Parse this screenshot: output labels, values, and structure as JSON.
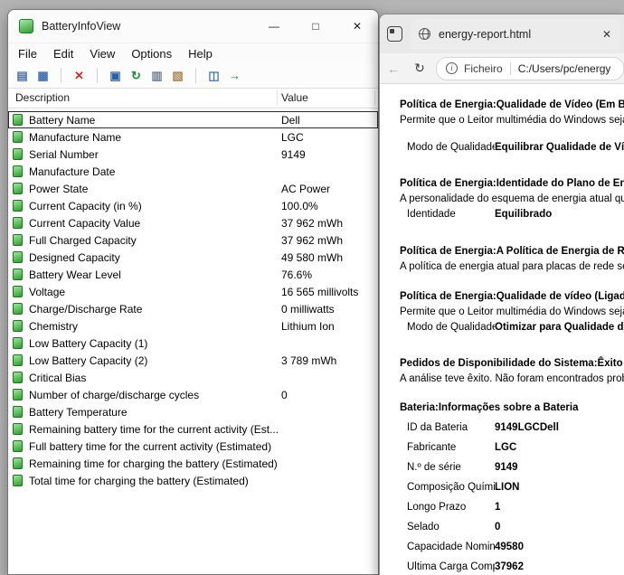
{
  "battery_window": {
    "title": "BatteryInfoView",
    "controls": {
      "minimize": "—",
      "maximize": "□",
      "close": "✕"
    },
    "menu_items": [
      "File",
      "Edit",
      "View",
      "Options",
      "Help"
    ],
    "toolbar": [
      {
        "name": "battery-info-view-icon",
        "glyph": "▤",
        "color": "#3f6fae"
      },
      {
        "name": "battery-log-view-icon",
        "glyph": "▦",
        "color": "#3f6fae"
      },
      {
        "separator": true
      },
      {
        "name": "delete-icon",
        "glyph": "✕",
        "color": "#d22d2d"
      },
      {
        "separator": true
      },
      {
        "name": "save-icon",
        "glyph": "▣",
        "color": "#2d5fa8"
      },
      {
        "name": "refresh-icon",
        "glyph": "↻",
        "color": "#1f8a3b"
      },
      {
        "name": "copy-icon",
        "glyph": "▥",
        "color": "#6f7d92"
      },
      {
        "name": "paste-icon",
        "glyph": "▧",
        "color": "#a8834e"
      },
      {
        "separator": true
      },
      {
        "name": "html-report-icon",
        "glyph": "◫",
        "color": "#3f6fae"
      },
      {
        "name": "exit-icon",
        "glyph": "→",
        "color": "#1f8a3b"
      }
    ],
    "columns": [
      "Description",
      "Value"
    ],
    "rows": [
      {
        "description": "Battery Name",
        "value": "Dell",
        "selected": true
      },
      {
        "description": "Manufacture Name",
        "value": "LGC"
      },
      {
        "description": "Serial Number",
        "value": "9149"
      },
      {
        "description": "Manufacture Date",
        "value": ""
      },
      {
        "description": "Power State",
        "value": "AC Power"
      },
      {
        "description": "Current Capacity (in %)",
        "value": "100.0%"
      },
      {
        "description": "Current Capacity Value",
        "value": "37 962 mWh"
      },
      {
        "description": "Full Charged Capacity",
        "value": "37 962 mWh"
      },
      {
        "description": "Designed Capacity",
        "value": "49 580 mWh"
      },
      {
        "description": "Battery Wear Level",
        "value": "76.6%"
      },
      {
        "description": "Voltage",
        "value": "16 565 millivolts"
      },
      {
        "description": "Charge/Discharge Rate",
        "value": "0 milliwatts"
      },
      {
        "description": "Chemistry",
        "value": "Lithium Ion"
      },
      {
        "description": "Low Battery Capacity (1)",
        "value": ""
      },
      {
        "description": "Low Battery Capacity (2)",
        "value": "3 789 mWh"
      },
      {
        "description": "Critical Bias",
        "value": ""
      },
      {
        "description": "Number of charge/discharge cycles",
        "value": "0"
      },
      {
        "description": "Battery Temperature",
        "value": ""
      },
      {
        "description": "Remaining battery time for the current activity (Est...",
        "value": ""
      },
      {
        "description": "Full battery time for the current activity (Estimated)",
        "value": ""
      },
      {
        "description": "Remaining time for charging the battery (Estimated)",
        "value": ""
      },
      {
        "description": "Total time for charging the battery (Estimated)",
        "value": ""
      }
    ]
  },
  "browser_window": {
    "tab_title": "energy-report.html",
    "icons": {
      "tab_close": "✕",
      "back": "←",
      "refresh": "↻"
    },
    "address": {
      "scheme_label": "Ficheiro",
      "path": "C:/Users/pc/energy"
    },
    "sections": [
      {
        "heading": "Política de Energia:Qualidade de Vídeo (Em Bat",
        "body": "Permite que o Leitor multimédia do Windows seja ot",
        "kv": {
          "label": "Modo de Qualidade",
          "value": "Equilibrar Qualidade de Ví"
        }
      },
      {
        "heading": "Política de Energia:Identidade do Plano de Ene",
        "body": "A personalidade do esquema de energia atual quand",
        "kv": {
          "label": "Identidade",
          "value": "Equilibrado"
        }
      },
      {
        "heading": "Política de Energia:A Política de Energia de Rád",
        "body": "A política de energia atual para placas de rede sem"
      },
      {
        "heading": "Política de Energia:Qualidade de vídeo (Ligado",
        "body": "Permite que o Leitor multimédia do Windows seja ot",
        "kv": {
          "label": "Modo de Qualidade",
          "value": "Otimizar para Qualidade d"
        }
      },
      {
        "heading": "Pedidos de Disponibilidade do Sistema:Êxito da",
        "body": "A análise teve êxito. Não foram encontrados probler"
      },
      {
        "heading": "Bateria:Informações sobre a Bateria",
        "rows": [
          {
            "label": "ID da Bateria",
            "value": "9149LGCDell"
          },
          {
            "label": "Fabricante",
            "value": "LGC"
          },
          {
            "label": "N.º de série",
            "value": "9149"
          },
          {
            "label": "Composição Química",
            "value": "LION"
          },
          {
            "label": "Longo Prazo",
            "value": "1"
          },
          {
            "label": "Selado",
            "value": "0"
          },
          {
            "label": "Capacidade Nominal",
            "value": "49580"
          },
          {
            "label": "Última Carga Completa",
            "value": "37962"
          }
        ]
      }
    ]
  }
}
